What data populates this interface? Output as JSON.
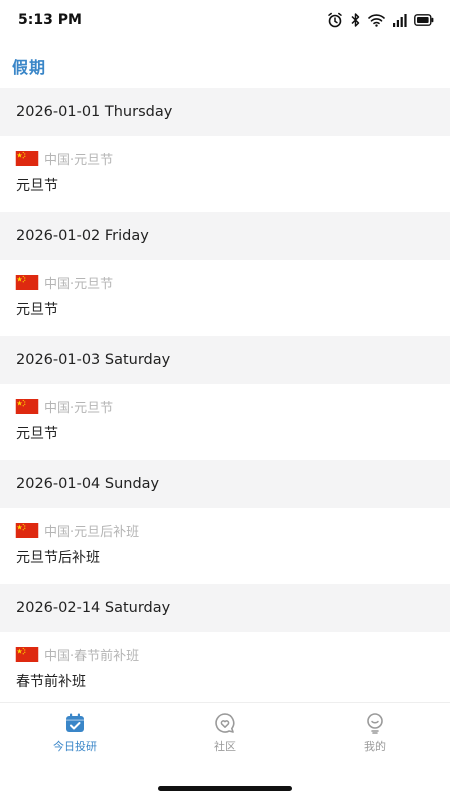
{
  "status_bar": {
    "time": "5:13 PM",
    "icons": [
      "alarm-icon",
      "bluetooth-icon",
      "wifi-icon",
      "signal-icon",
      "battery-icon"
    ]
  },
  "header": {
    "title": "假期"
  },
  "holidays": [
    {
      "date": "2026-01-01 Thursday",
      "source": "中国·元旦节",
      "name": "元旦节",
      "flag": "china-flag-icon"
    },
    {
      "date": "2026-01-02 Friday",
      "source": "中国·元旦节",
      "name": "元旦节",
      "flag": "china-flag-icon"
    },
    {
      "date": "2026-01-03 Saturday",
      "source": "中国·元旦节",
      "name": "元旦节",
      "flag": "china-flag-icon"
    },
    {
      "date": "2026-01-04 Sunday",
      "source": "中国·元旦后补班",
      "name": "元旦节后补班",
      "flag": "china-flag-icon"
    },
    {
      "date": "2026-02-14 Saturday",
      "source": "中国·春节前补班",
      "name": "春节前补班",
      "flag": "china-flag-icon"
    }
  ],
  "tabbar": {
    "tabs": [
      {
        "label": "今日投研",
        "icon": "calendar-check-icon",
        "active": true
      },
      {
        "label": "社区",
        "icon": "heart-chat-icon",
        "active": false
      },
      {
        "label": "我的",
        "icon": "lightbulb-icon",
        "active": false
      }
    ]
  },
  "colors": {
    "accent": "#3a86c8",
    "section_bg": "#f4f4f5",
    "muted_text": "#b5b5b5",
    "flag_red": "#de2910",
    "flag_yellow": "#ffde00"
  }
}
